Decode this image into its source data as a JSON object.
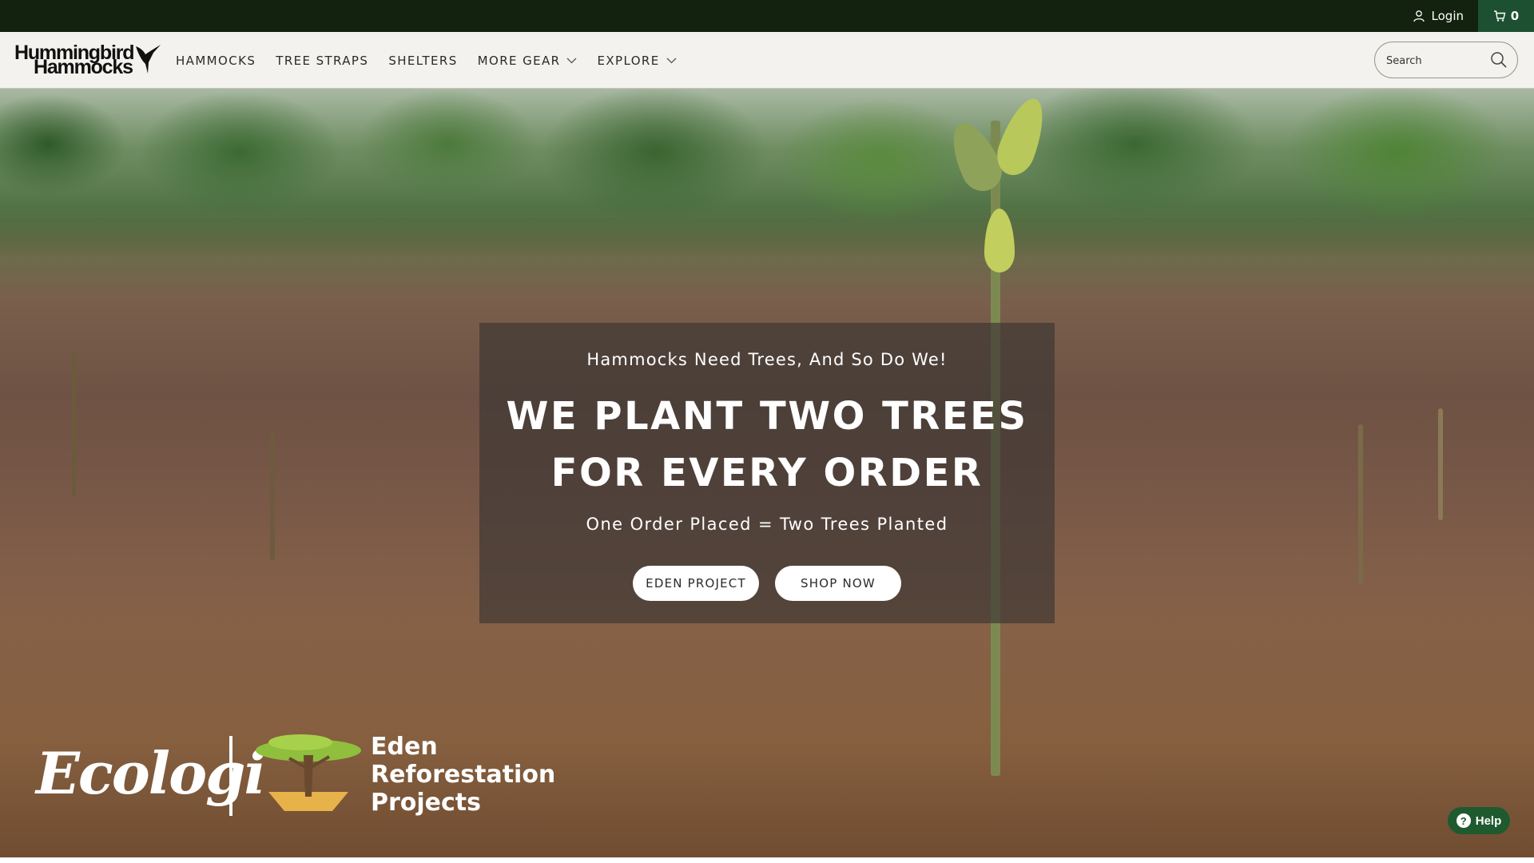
{
  "topbar": {
    "login_label": "Login",
    "cart_count": "0"
  },
  "header": {
    "logo_line1": "Hummingbird",
    "logo_line2": "Hammocks",
    "nav": [
      {
        "label": "HAMMOCKS",
        "has_dropdown": false
      },
      {
        "label": "TREE STRAPS",
        "has_dropdown": false
      },
      {
        "label": "SHELTERS",
        "has_dropdown": false
      },
      {
        "label": "MORE GEAR",
        "has_dropdown": true
      },
      {
        "label": "EXPLORE",
        "has_dropdown": true
      }
    ],
    "search_placeholder": "Search"
  },
  "hero": {
    "pretitle": "Hammocks Need Trees, And So Do We!",
    "headline_line1": "WE PLANT TWO TREES",
    "headline_line2": "FOR EVERY ORDER",
    "subtitle": "One Order Placed = Two Trees Planted",
    "button_eden": "EDEN PROJECT",
    "button_shop": "SHOP NOW"
  },
  "partners": {
    "ecologi": "Ecologi",
    "eden_line1": "Eden",
    "eden_line2": "Reforestation",
    "eden_line3": "Projects"
  },
  "help": {
    "label": "Help"
  },
  "colors": {
    "topbar_bg": "#13210f",
    "cart_bg": "#1d5030",
    "header_bg": "#f4f2ee",
    "overlay_bg": "rgba(60,55,52,0.68)",
    "help_bg": "#1f5a2f"
  },
  "icons": {
    "login": "user-icon",
    "cart": "cart-icon",
    "search": "search-icon",
    "dropdown": "chevron-down-icon",
    "help": "question-icon",
    "logo_bird": "hummingbird-icon"
  }
}
